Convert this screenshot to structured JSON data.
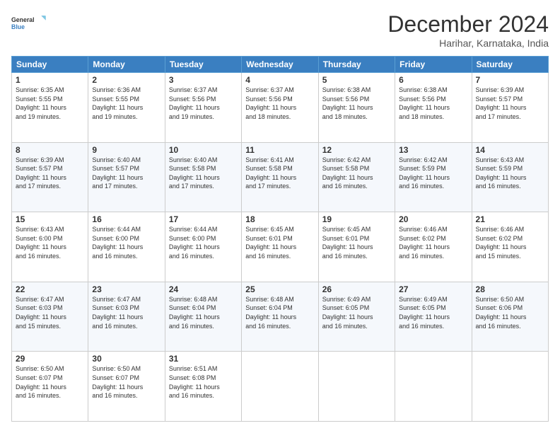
{
  "header": {
    "logo_line1": "General",
    "logo_line2": "Blue",
    "month": "December 2024",
    "location": "Harihar, Karnataka, India"
  },
  "days_of_week": [
    "Sunday",
    "Monday",
    "Tuesday",
    "Wednesday",
    "Thursday",
    "Friday",
    "Saturday"
  ],
  "weeks": [
    [
      {
        "day": "1",
        "info": "Sunrise: 6:35 AM\nSunset: 5:55 PM\nDaylight: 11 hours\nand 19 minutes."
      },
      {
        "day": "2",
        "info": "Sunrise: 6:36 AM\nSunset: 5:55 PM\nDaylight: 11 hours\nand 19 minutes."
      },
      {
        "day": "3",
        "info": "Sunrise: 6:37 AM\nSunset: 5:56 PM\nDaylight: 11 hours\nand 19 minutes."
      },
      {
        "day": "4",
        "info": "Sunrise: 6:37 AM\nSunset: 5:56 PM\nDaylight: 11 hours\nand 18 minutes."
      },
      {
        "day": "5",
        "info": "Sunrise: 6:38 AM\nSunset: 5:56 PM\nDaylight: 11 hours\nand 18 minutes."
      },
      {
        "day": "6",
        "info": "Sunrise: 6:38 AM\nSunset: 5:56 PM\nDaylight: 11 hours\nand 18 minutes."
      },
      {
        "day": "7",
        "info": "Sunrise: 6:39 AM\nSunset: 5:57 PM\nDaylight: 11 hours\nand 17 minutes."
      }
    ],
    [
      {
        "day": "8",
        "info": "Sunrise: 6:39 AM\nSunset: 5:57 PM\nDaylight: 11 hours\nand 17 minutes."
      },
      {
        "day": "9",
        "info": "Sunrise: 6:40 AM\nSunset: 5:57 PM\nDaylight: 11 hours\nand 17 minutes."
      },
      {
        "day": "10",
        "info": "Sunrise: 6:40 AM\nSunset: 5:58 PM\nDaylight: 11 hours\nand 17 minutes."
      },
      {
        "day": "11",
        "info": "Sunrise: 6:41 AM\nSunset: 5:58 PM\nDaylight: 11 hours\nand 17 minutes."
      },
      {
        "day": "12",
        "info": "Sunrise: 6:42 AM\nSunset: 5:58 PM\nDaylight: 11 hours\nand 16 minutes."
      },
      {
        "day": "13",
        "info": "Sunrise: 6:42 AM\nSunset: 5:59 PM\nDaylight: 11 hours\nand 16 minutes."
      },
      {
        "day": "14",
        "info": "Sunrise: 6:43 AM\nSunset: 5:59 PM\nDaylight: 11 hours\nand 16 minutes."
      }
    ],
    [
      {
        "day": "15",
        "info": "Sunrise: 6:43 AM\nSunset: 6:00 PM\nDaylight: 11 hours\nand 16 minutes."
      },
      {
        "day": "16",
        "info": "Sunrise: 6:44 AM\nSunset: 6:00 PM\nDaylight: 11 hours\nand 16 minutes."
      },
      {
        "day": "17",
        "info": "Sunrise: 6:44 AM\nSunset: 6:00 PM\nDaylight: 11 hours\nand 16 minutes."
      },
      {
        "day": "18",
        "info": "Sunrise: 6:45 AM\nSunset: 6:01 PM\nDaylight: 11 hours\nand 16 minutes."
      },
      {
        "day": "19",
        "info": "Sunrise: 6:45 AM\nSunset: 6:01 PM\nDaylight: 11 hours\nand 16 minutes."
      },
      {
        "day": "20",
        "info": "Sunrise: 6:46 AM\nSunset: 6:02 PM\nDaylight: 11 hours\nand 16 minutes."
      },
      {
        "day": "21",
        "info": "Sunrise: 6:46 AM\nSunset: 6:02 PM\nDaylight: 11 hours\nand 15 minutes."
      }
    ],
    [
      {
        "day": "22",
        "info": "Sunrise: 6:47 AM\nSunset: 6:03 PM\nDaylight: 11 hours\nand 15 minutes."
      },
      {
        "day": "23",
        "info": "Sunrise: 6:47 AM\nSunset: 6:03 PM\nDaylight: 11 hours\nand 16 minutes."
      },
      {
        "day": "24",
        "info": "Sunrise: 6:48 AM\nSunset: 6:04 PM\nDaylight: 11 hours\nand 16 minutes."
      },
      {
        "day": "25",
        "info": "Sunrise: 6:48 AM\nSunset: 6:04 PM\nDaylight: 11 hours\nand 16 minutes."
      },
      {
        "day": "26",
        "info": "Sunrise: 6:49 AM\nSunset: 6:05 PM\nDaylight: 11 hours\nand 16 minutes."
      },
      {
        "day": "27",
        "info": "Sunrise: 6:49 AM\nSunset: 6:05 PM\nDaylight: 11 hours\nand 16 minutes."
      },
      {
        "day": "28",
        "info": "Sunrise: 6:50 AM\nSunset: 6:06 PM\nDaylight: 11 hours\nand 16 minutes."
      }
    ],
    [
      {
        "day": "29",
        "info": "Sunrise: 6:50 AM\nSunset: 6:07 PM\nDaylight: 11 hours\nand 16 minutes."
      },
      {
        "day": "30",
        "info": "Sunrise: 6:50 AM\nSunset: 6:07 PM\nDaylight: 11 hours\nand 16 minutes."
      },
      {
        "day": "31",
        "info": "Sunrise: 6:51 AM\nSunset: 6:08 PM\nDaylight: 11 hours\nand 16 minutes."
      },
      {
        "day": "",
        "info": ""
      },
      {
        "day": "",
        "info": ""
      },
      {
        "day": "",
        "info": ""
      },
      {
        "day": "",
        "info": ""
      }
    ]
  ]
}
